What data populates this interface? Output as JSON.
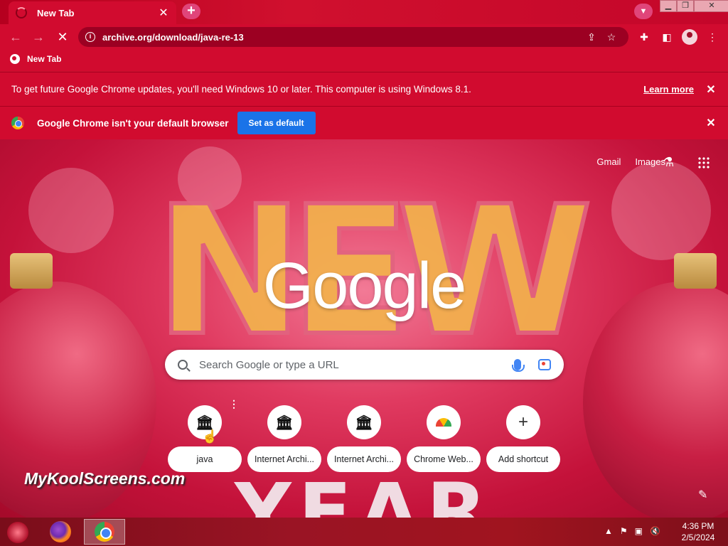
{
  "browser": {
    "tab_title": "New Tab",
    "url": "archive.org/download/java-re-13",
    "bookmark_label": "New Tab"
  },
  "infobars": {
    "update_message": "To get future Google Chrome updates, you'll need Windows 10 or later. This computer is using Windows 8.1.",
    "learn_more": "Learn more",
    "default_message": "Google Chrome isn't your default browser",
    "set_default": "Set as default"
  },
  "ntp": {
    "links": [
      "Gmail",
      "Images"
    ],
    "logo_text": "Google",
    "search_placeholder": "Search Google or type a URL",
    "background_text_top": "NEW",
    "background_text_bottom": "YEAR",
    "shortcuts": [
      {
        "label": "java",
        "icon": "archive-icon"
      },
      {
        "label": "Internet Archi...",
        "icon": "archive-icon"
      },
      {
        "label": "Internet Archi...",
        "icon": "archive-icon"
      },
      {
        "label": "Chrome Web...",
        "icon": "chrome-web-store-icon"
      },
      {
        "label": "Add shortcut",
        "icon": "plus-icon"
      }
    ]
  },
  "watermark": "MyKoolScreens.com",
  "taskbar": {
    "time": "4:36 PM",
    "date": "2/5/2024"
  },
  "colors": {
    "theme_red": "#d10b2f",
    "set_default_blue": "#1a73e8"
  }
}
